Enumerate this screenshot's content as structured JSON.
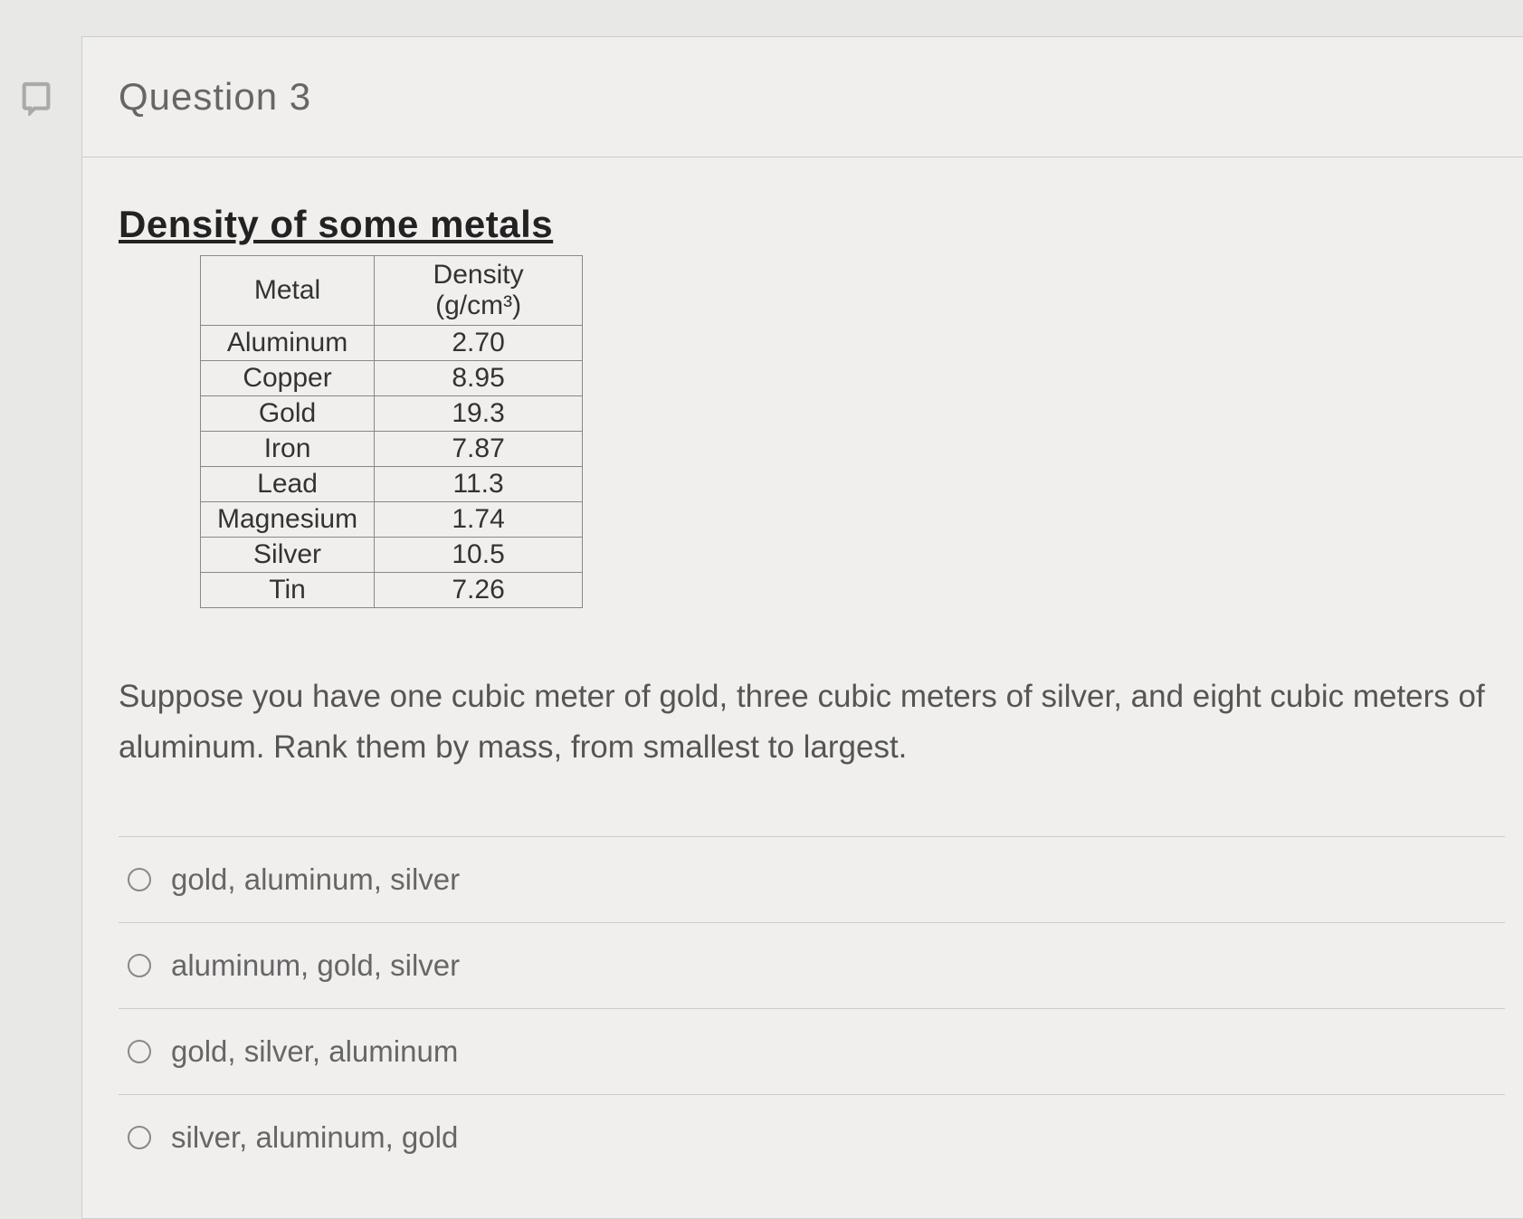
{
  "question": {
    "number_label": "Question 3",
    "table_title": "Density of some metals",
    "table": {
      "headers": {
        "metal": "Metal",
        "density": "Density (g/cm³)"
      },
      "rows": [
        {
          "metal": "Aluminum",
          "density": "2.70"
        },
        {
          "metal": "Copper",
          "density": "8.95"
        },
        {
          "metal": "Gold",
          "density": "19.3"
        },
        {
          "metal": "Iron",
          "density": "7.87"
        },
        {
          "metal": "Lead",
          "density": "11.3"
        },
        {
          "metal": "Magnesium",
          "density": "1.74"
        },
        {
          "metal": "Silver",
          "density": "10.5"
        },
        {
          "metal": "Tin",
          "density": "7.26"
        }
      ]
    },
    "prompt": "Suppose you have one cubic meter of gold, three cubic meters of silver, and eight cubic meters of aluminum. Rank them by mass, from smallest to largest.",
    "options": [
      "gold, aluminum, silver",
      "aluminum, gold, silver",
      "gold, silver, aluminum",
      "silver, aluminum, gold"
    ]
  }
}
